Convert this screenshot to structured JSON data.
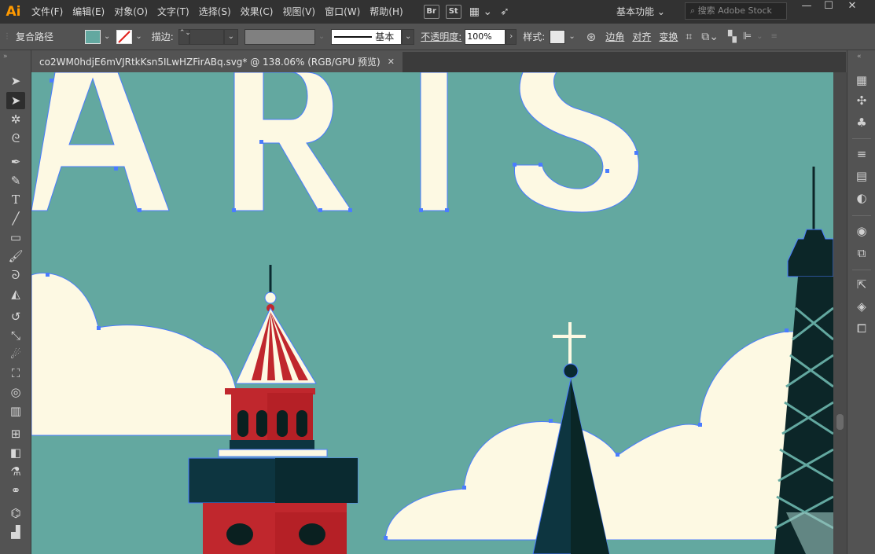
{
  "app": {
    "logo": "Ai"
  },
  "menu": [
    "文件(F)",
    "编辑(E)",
    "对象(O)",
    "文字(T)",
    "选择(S)",
    "效果(C)",
    "视图(V)",
    "窗口(W)",
    "帮助(H)"
  ],
  "menu_icons": {
    "bridge": "Br",
    "stock": "St"
  },
  "workspace": {
    "label": "基本功能 ⌄"
  },
  "search": {
    "placeholder": "搜索 Adobe Stock"
  },
  "window_controls": {
    "minimize": "—",
    "maximize": "☐",
    "close": "✕"
  },
  "controlbar": {
    "selection_label": "复合路径",
    "stroke_label": "描边:",
    "stroke_weight": "",
    "brush_label": "基本",
    "opacity_label": "不透明度:",
    "opacity_value": "100%",
    "style_label": "样式:",
    "corner_label": "边角",
    "align_label": "对齐",
    "transform_label": "变换"
  },
  "document": {
    "tab_label": "co2WM0hdjE6mVJRtkKsn5ILwHZFirABq.svg* @ 138.06% (RGB/GPU 预览)",
    "close": "✕"
  },
  "colors": {
    "sky": "#63a8a0",
    "cream": "#fdf9e3",
    "tower_red": "#c0272d",
    "tower_dark": "#0d3540",
    "spire_dark": "#0a2a30",
    "eiffel": "#0c2628",
    "anchor": "#4a7cff",
    "fill_swatch": "#63a8a0"
  },
  "artwork": {
    "title_letters": "A R I S"
  },
  "tools": [
    "selection-tool",
    "direct-selection-tool",
    "magic-wand-tool",
    "lasso-tool",
    "pen-tool",
    "curvature-tool",
    "type-tool",
    "line-tool",
    "rectangle-tool",
    "paintbrush-tool",
    "shaper-tool",
    "eraser-tool",
    "rotate-tool",
    "scale-tool",
    "warp-tool",
    "free-transform-tool",
    "shape-builder-tool",
    "perspective-tool",
    "mesh-tool",
    "gradient-tool",
    "eyedropper-tool",
    "blend-tool",
    "symbol-sprayer-tool",
    "column-graph-tool"
  ],
  "right_panel": [
    "color-guide-icon",
    "brushes-icon",
    "symbols-icon",
    "stroke-icon",
    "gradient-icon",
    "transparency-icon",
    "appearance-icon",
    "graphic-styles-icon",
    "export-icon",
    "layers-icon",
    "artboards-icon"
  ]
}
